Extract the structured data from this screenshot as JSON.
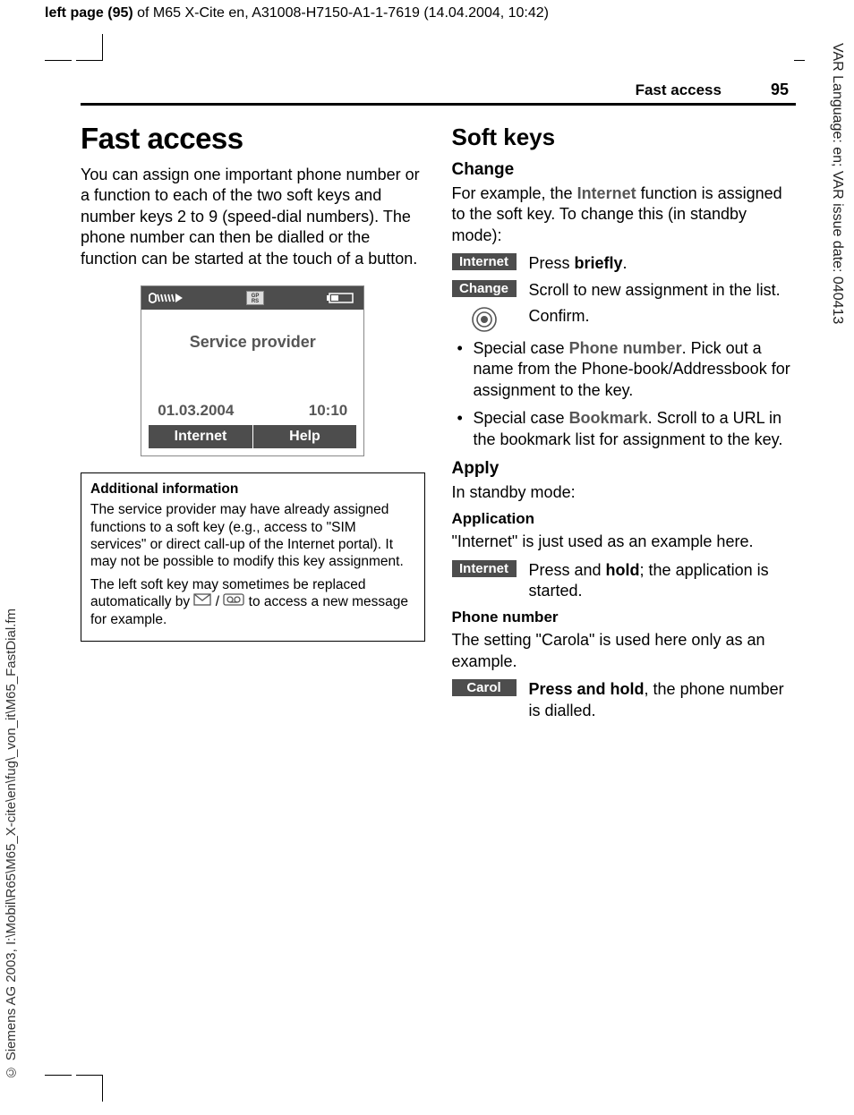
{
  "top_header": {
    "bold": "left page (95)",
    "rest": " of M65 X-Cite en, A31008-H7150-A1-1-7619 (14.04.2004, 10:42)"
  },
  "side_left": "© Siemens AG 2003, I:\\Mobil\\R65\\M65_X-cite\\en\\fug\\_von_it\\M65_FastDial.fm",
  "side_right": "VAR Language: en; VAR issue date: 040413",
  "running": {
    "title": "Fast access",
    "number": "95"
  },
  "h1": "Fast access",
  "intro": "You can assign one important phone number or a function to each of the two soft keys and number keys 2 to 9 (speed-dial numbers). The phone number can then be dialled or the function can be started at the touch of a button.",
  "phone": {
    "gprs": "GP\nRS",
    "service_provider": "Service provider",
    "date": "01.03.2004",
    "time": "10:10",
    "soft_left": "Internet",
    "soft_right": "Help"
  },
  "info": {
    "header": "Additional information",
    "p1": "The service provider may have already assigned functions to a soft key (e.g., access to \"SIM services\" or direct call-up of the Internet portal). It may not be possible to modify this key assignment.",
    "p2a": "The left soft key may sometimes be replaced automatically by ",
    "p2b": " to access a new message for example."
  },
  "softkeys": {
    "title": "Soft keys",
    "change": {
      "h": "Change",
      "intro_a": "For example, the ",
      "intro_ui": "Internet",
      "intro_b": " function is assigned to the soft key. To change this (in standby mode):",
      "step1_label": "Internet",
      "step1_text_a": "Press ",
      "step1_text_b": "briefly",
      "step1_text_c": ".",
      "step2_label": "Change",
      "step2_text": "Scroll to new assignment in the list.",
      "step3_text": "Confirm.",
      "bullet1_a": "Special case ",
      "bullet1_ui": "Phone number",
      "bullet1_b": ". Pick out a name from the Phone-book/Addressbook for assignment to the key.",
      "bullet2_a": "Special case ",
      "bullet2_ui": "Bookmark",
      "bullet2_b": ". Scroll to a URL in the bookmark list for assignment to the key."
    },
    "apply": {
      "h": "Apply",
      "intro": "In standby mode:",
      "app_h": "Application",
      "app_text": "\"Internet\" is just used as an example here.",
      "app_label": "Internet",
      "app_step_a": "Press and ",
      "app_step_b": "hold",
      "app_step_c": "; the application is started.",
      "ph_h": "Phone number",
      "ph_text": "The setting \"Carola\" is used here only as an example.",
      "ph_label": "Carol",
      "ph_step_a": "Press and hold",
      "ph_step_b": ", the phone number is dialled."
    }
  }
}
